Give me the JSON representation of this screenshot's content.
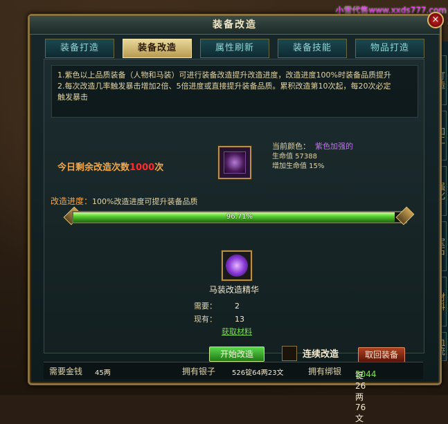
{
  "watermark": "小雪代售www.xxds777.com",
  "side_tabs": [
    "打造",
    "加工",
    "强化",
    "宝石",
    "材料",
    "血统"
  ],
  "dialog": {
    "title": "装备改造",
    "close_label": "×",
    "tabs": [
      {
        "label": "装备打造",
        "active": false
      },
      {
        "label": "装备改造",
        "active": true
      },
      {
        "label": "属性刷新",
        "active": false
      },
      {
        "label": "装备技能",
        "active": false
      },
      {
        "label": "物品打造",
        "active": false
      }
    ],
    "info_lines": [
      "1.紫色以上品质装备（人物和马装）可进行装备改造提升改造进度，改造进度100%时装备品质提升",
      "2.每次改造几率触发暴击增加2倍、5倍进度或直接提升装备品质。累积改造第10次起，每20次必定",
      "触发暴击"
    ],
    "remaining_prefix": "今日剩余改造次数",
    "remaining_count": "1000",
    "remaining_suffix": "次",
    "current_color_label": "当前颜色：",
    "current_color_value": "紫色加强的",
    "hp_line": "生命值 57388",
    "hp_bonus_line": "增加生命值 15%",
    "progress_label": "改造进度：",
    "progress_desc": "100%改造进度可提升装备品质",
    "progress_percent": 96.71,
    "progress_text": "96.71%",
    "material_name": "马装改造精华",
    "need_label": "需要：",
    "need_value": "2",
    "have_label": "现有：",
    "have_value": "13",
    "get_material_label": "获取材料",
    "start_button": "开始改造",
    "continuous_label": "连续改造",
    "continuous_checked": false,
    "retrieve_button": "取回装备",
    "footer": {
      "gold_label": "需要金钱",
      "gold_value": "45两",
      "silver_label": "拥有银子",
      "silver_value": "526锭64两23文",
      "bound_label": "拥有绑银",
      "bound_value_green": "3044",
      "bound_value_rest": "锭26两76文"
    }
  },
  "colors": {
    "frame": "#8a7342",
    "active_tab": "#e8d89a",
    "progress_green": "#5ad030",
    "remain_count": "#ff2a2a",
    "purple_quality": "#c070f0"
  }
}
